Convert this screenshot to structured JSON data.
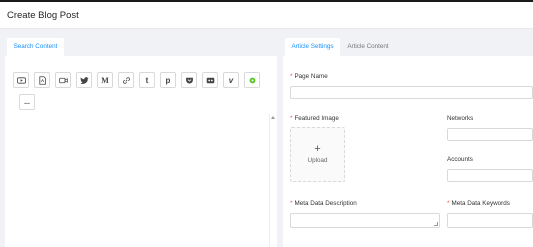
{
  "header": {
    "title": "Create Blog Post"
  },
  "left": {
    "tab": "Search Content",
    "toolbar_icons": [
      "youtube-icon",
      "pdf-icon",
      "video-icon",
      "twitter-icon",
      "medium-icon",
      "link-icon",
      "tumblr-icon",
      "pinterest-icon",
      "pocket-icon",
      "slideshare-icon",
      "vimeo-icon",
      "podcast-icon"
    ],
    "more_label": "..."
  },
  "right": {
    "tabs": [
      {
        "label": "Article Settings",
        "active": true
      },
      {
        "label": "Article Content",
        "active": false
      }
    ],
    "fields": {
      "page_name": {
        "label": "Page Name",
        "required": true
      },
      "featured_image": {
        "label": "Featured Image",
        "required": true
      },
      "networks": {
        "label": "Networks"
      },
      "accounts": {
        "label": "Accounts"
      },
      "meta_description": {
        "label": "Meta Data Description",
        "required": true
      },
      "meta_keywords": {
        "label": "Meta Data Keywords",
        "required": true
      }
    },
    "upload": {
      "plus": "+",
      "label": "Upload"
    },
    "required_marker": "*"
  },
  "colors": {
    "accent": "#1890ff",
    "required": "#ff4d4f",
    "background": "#f0f2f5"
  }
}
